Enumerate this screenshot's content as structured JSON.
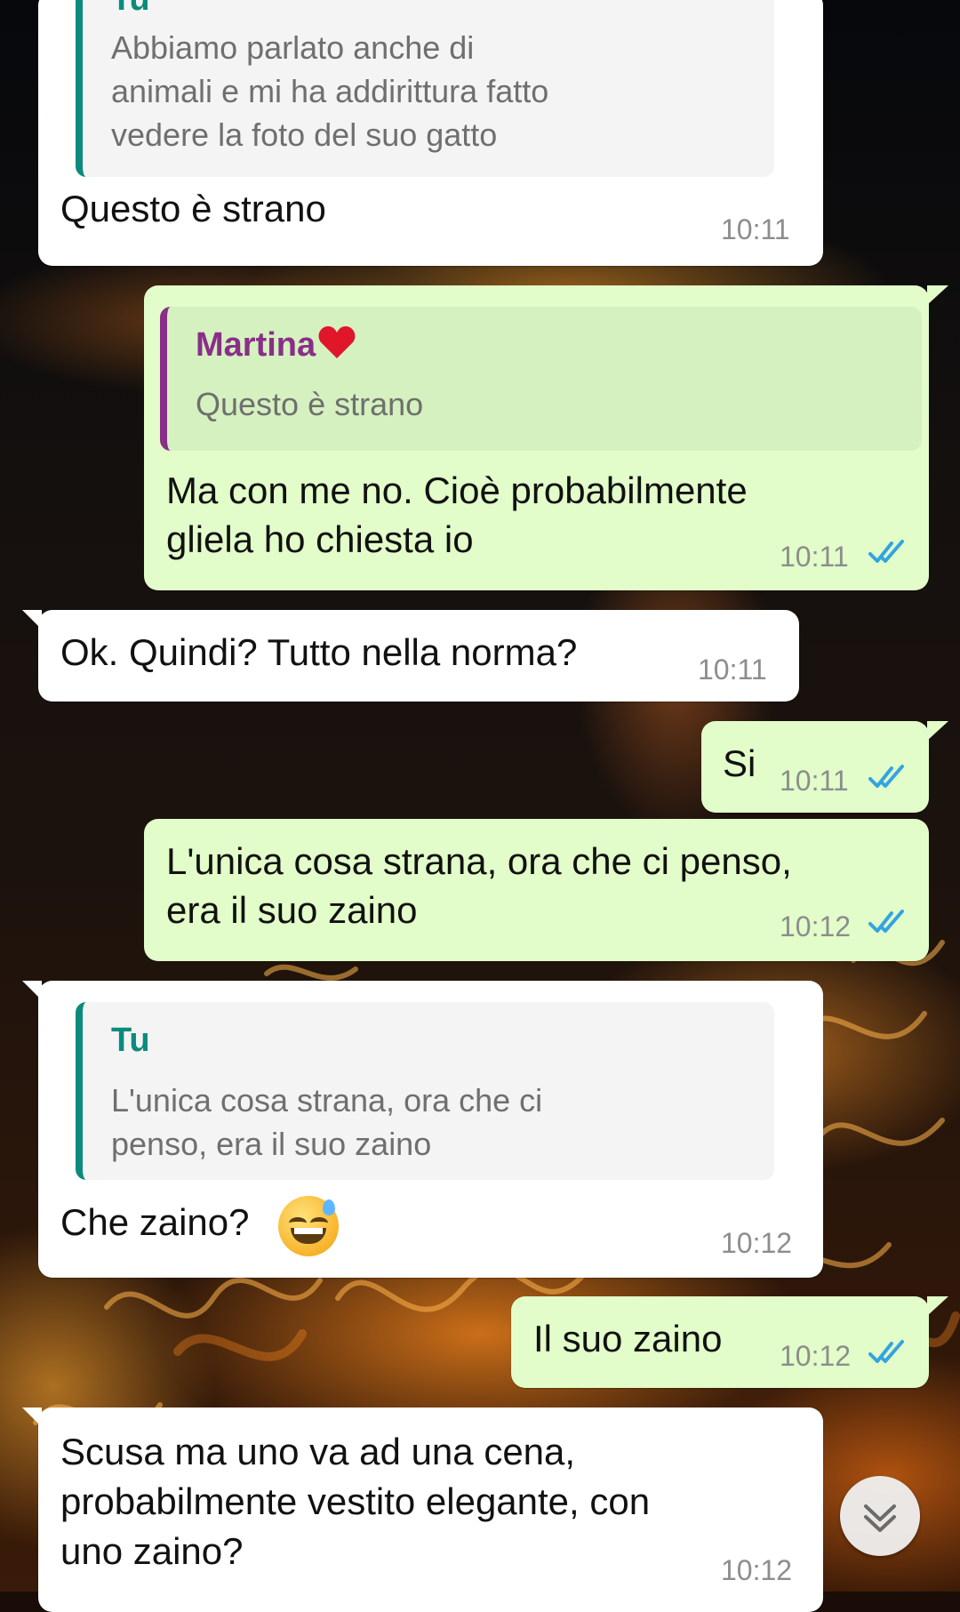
{
  "chat": {
    "messages": [
      {
        "direction": "incoming",
        "quote": {
          "sender": "Tu",
          "lines": [
            "Abbiamo parlato anche di",
            "animali e mi ha addirittura fatto",
            "vedere la foto del suo gatto"
          ]
        },
        "lines": [
          "Questo è strano"
        ],
        "time": "10:11"
      },
      {
        "direction": "outgoing",
        "quote": {
          "sender": "Martina",
          "sender_emoji": "red-heart",
          "lines": [
            "Questo è strano"
          ]
        },
        "lines": [
          "Ma con me no. Cioè probabilmente",
          "gliela ho chiesta io"
        ],
        "time": "10:11",
        "status": "read"
      },
      {
        "direction": "incoming",
        "lines": [
          "Ok. Quindi? Tutto nella norma?"
        ],
        "time": "10:11"
      },
      {
        "direction": "outgoing",
        "lines": [
          "Si"
        ],
        "time": "10:11",
        "status": "read"
      },
      {
        "direction": "outgoing",
        "lines": [
          "L'unica cosa strana, ora che ci penso,",
          "era il suo zaino"
        ],
        "time": "10:12",
        "status": "read"
      },
      {
        "direction": "incoming",
        "quote": {
          "sender": "Tu",
          "lines": [
            "L'unica cosa strana, ora che ci",
            "penso, era il suo zaino"
          ]
        },
        "lines": [
          "Che zaino?"
        ],
        "emoji": "grinning-face-with-sweat",
        "time": "10:12"
      },
      {
        "direction": "outgoing",
        "lines": [
          "Il suo zaino"
        ],
        "time": "10:12",
        "status": "read"
      },
      {
        "direction": "incoming",
        "lines": [
          "Scusa ma uno va ad una cena,",
          "probabilmente vestito elegante, con",
          "uno zaino?"
        ],
        "time": "10:12"
      }
    ]
  },
  "colors": {
    "incoming_bubble": "#ffffff",
    "outgoing_bubble": "#e2fdc9",
    "quote_tu_accent": "#0a8b7d",
    "quote_martina_accent": "#8a2e8a",
    "read_ticks": "#34a3e0",
    "time_text": "#8d8d8d"
  },
  "icons": {
    "scroll_down": "double-chevron-down-icon",
    "read_receipt": "double-check-icon"
  }
}
